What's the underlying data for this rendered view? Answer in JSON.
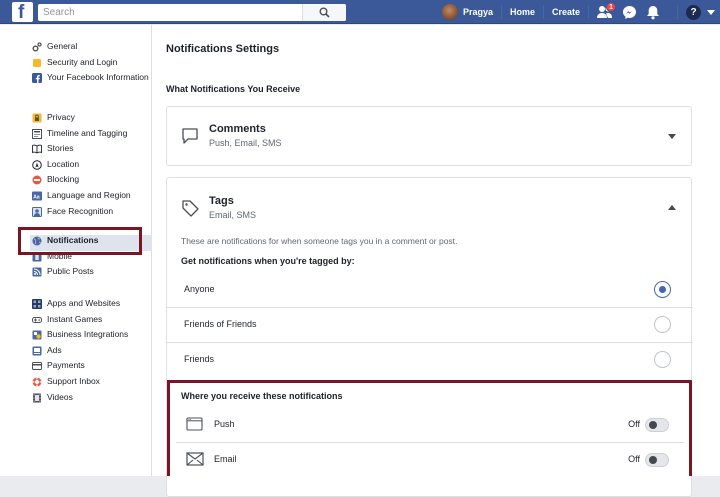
{
  "topbar": {
    "logo_letter": "f",
    "search_placeholder": "Search",
    "user_name": "Pragya",
    "home": "Home",
    "create": "Create",
    "friend_requests_badge": "1",
    "help_glyph": "?"
  },
  "sidebar": {
    "group1": [
      {
        "label": "General",
        "icon": "gears-icon"
      },
      {
        "label": "Security and Login",
        "icon": "shield-icon"
      },
      {
        "label": "Your Facebook Information",
        "icon": "facebook-icon"
      }
    ],
    "group2": [
      {
        "label": "Privacy",
        "icon": "lock-icon"
      },
      {
        "label": "Timeline and Tagging",
        "icon": "timeline-icon"
      },
      {
        "label": "Stories",
        "icon": "book-icon"
      },
      {
        "label": "Location",
        "icon": "location-icon"
      },
      {
        "label": "Blocking",
        "icon": "blocking-icon"
      },
      {
        "label": "Language and Region",
        "icon": "language-icon"
      },
      {
        "label": "Face Recognition",
        "icon": "face-icon"
      }
    ],
    "group3": [
      {
        "label": "Notifications",
        "icon": "globe-icon",
        "active": true
      },
      {
        "label": "Mobile",
        "icon": "mobile-icon"
      },
      {
        "label": "Public Posts",
        "icon": "rss-icon"
      }
    ],
    "group4": [
      {
        "label": "Apps and Websites",
        "icon": "apps-icon"
      },
      {
        "label": "Instant Games",
        "icon": "gamepad-icon"
      },
      {
        "label": "Business Integrations",
        "icon": "business-icon"
      },
      {
        "label": "Ads",
        "icon": "ads-icon"
      },
      {
        "label": "Payments",
        "icon": "card-icon"
      },
      {
        "label": "Support Inbox",
        "icon": "lifebuoy-icon"
      },
      {
        "label": "Videos",
        "icon": "film-icon"
      }
    ]
  },
  "main": {
    "page_title": "Notifications Settings",
    "section_title": "What Notifications You Receive",
    "comments": {
      "title": "Comments",
      "subtitle": "Push, Email, SMS"
    },
    "tags": {
      "title": "Tags",
      "subtitle": "Email, SMS",
      "description": "These are notifications for when someone tags you in a comment or post.",
      "options_heading": "Get notifications when you're tagged by:",
      "options": [
        {
          "label": "Anyone",
          "selected": true
        },
        {
          "label": "Friends of Friends",
          "selected": false
        },
        {
          "label": "Friends",
          "selected": false
        }
      ],
      "receive_heading": "Where you receive these notifications",
      "channels": [
        {
          "label": "Push",
          "state": "Off"
        },
        {
          "label": "Email",
          "state": "Off"
        }
      ]
    }
  },
  "colors": {
    "brand": "#3b5998",
    "highlight": "#7a1621",
    "accent": "#4267b2"
  }
}
